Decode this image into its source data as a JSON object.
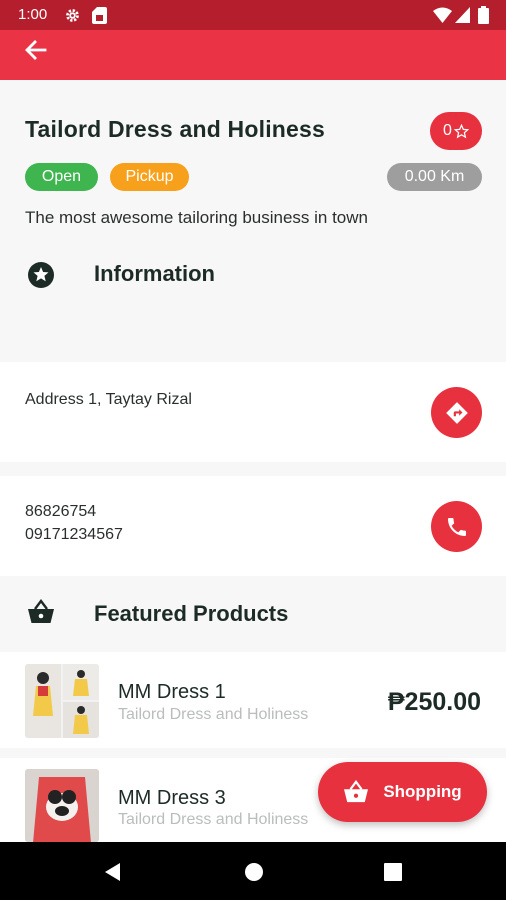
{
  "status_bar": {
    "time": "1:00",
    "icons": [
      "settings-icon",
      "sim-card-icon",
      "wifi-icon",
      "signal-icon",
      "battery-icon"
    ]
  },
  "app_bar": {
    "back_icon": "arrow-left-icon"
  },
  "store": {
    "name": "Tailord Dress and Holiness",
    "rating": "0",
    "rating_icon": "star-outline-icon",
    "status_chip": "Open",
    "delivery_chip": "Pickup",
    "distance": "0.00 Km",
    "description": "The most awesome tailoring business in town"
  },
  "information": {
    "heading": "Information",
    "address": "Address 1, Taytay Rizal",
    "phones": [
      "86826754",
      "09171234567"
    ]
  },
  "featured": {
    "heading": "Featured Products",
    "products": [
      {
        "name": "MM Dress 1",
        "shop": "Tailord Dress and Holiness",
        "price": "₱250.00"
      },
      {
        "name": "MM Dress 3",
        "shop": "Tailord Dress and Holiness",
        "price": ""
      }
    ]
  },
  "fab": {
    "label": "Shopping",
    "icon": "shopping-basket-icon"
  },
  "colors": {
    "primary": "#ea3445",
    "status_bar": "#b51f2d",
    "open_chip": "#3fb54f",
    "pickup_chip": "#f7a01b",
    "distance_chip": "#9e9e9e"
  }
}
